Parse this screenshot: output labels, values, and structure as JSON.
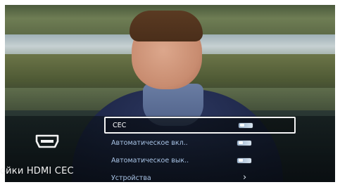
{
  "panel": {
    "title": "ойки HDMI CEC",
    "icon": "hdmi-port-icon"
  },
  "menu": {
    "items": [
      {
        "label": "CEC",
        "control": "toggle",
        "state": "on",
        "selected": true
      },
      {
        "label": "Автоматическое вкл..",
        "control": "toggle",
        "state": "on",
        "selected": false
      },
      {
        "label": "Автоматическое вык..",
        "control": "toggle",
        "state": "on",
        "selected": false
      },
      {
        "label": "Устройства",
        "control": "chevron",
        "selected": false
      }
    ]
  },
  "colors": {
    "selected_border": "#f4f4f4",
    "label_inactive": "#a9c4e6",
    "label_active": "#ffffff"
  }
}
